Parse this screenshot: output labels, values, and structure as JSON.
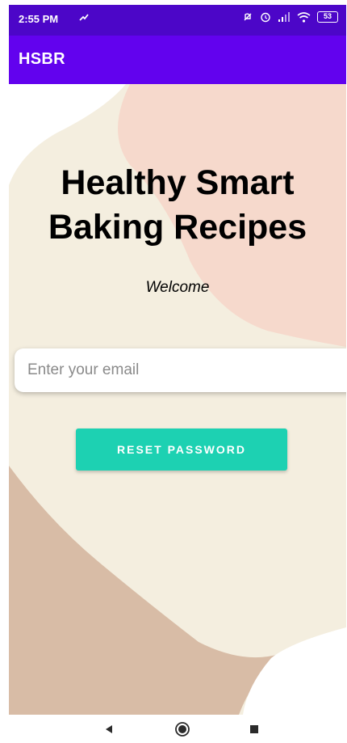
{
  "status_bar": {
    "time": "2:55 PM",
    "battery_level": "53"
  },
  "app_bar": {
    "title": "HSBR"
  },
  "main": {
    "headline": "Healthy Smart Baking Recipes",
    "subtitle": "Welcome",
    "email_placeholder": "Enter your email",
    "email_value": "",
    "reset_button_label": "RESET PASSWORD"
  },
  "nav_bar": {
    "icons": [
      "back-icon",
      "home-icon",
      "recents-icon"
    ]
  },
  "colors": {
    "status_bar": "#4c06c8",
    "app_bar": "#6202ee",
    "button": "#1dd1b2",
    "cream": "#f4eedf",
    "peach": "#f6d9cc",
    "tan": "#d8bca6"
  }
}
